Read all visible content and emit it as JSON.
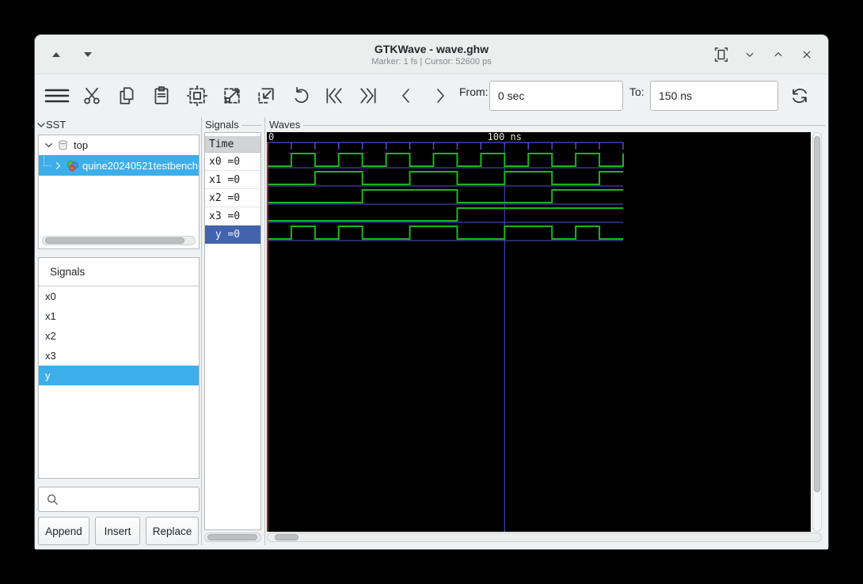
{
  "window": {
    "title": "GTKWave - wave.ghw",
    "subtitle": "Marker: 1 fs  |  Cursor: 52600 ps",
    "titlebar_icons": [
      "keep-above",
      "keep-below",
      "fit-window",
      "minimize",
      "maximize",
      "close"
    ]
  },
  "toolbar": {
    "icons": [
      "menu",
      "cut",
      "copy",
      "paste",
      "zoom-fit",
      "zoom-in",
      "zoom-out",
      "undo",
      "go-to-start",
      "go-to-end",
      "step-back",
      "step-forward",
      "reload"
    ],
    "from_label": "From:",
    "from_value": "0 sec",
    "to_label": "To:",
    "to_value": "150 ns"
  },
  "sst": {
    "label": "SST",
    "root_item": "top",
    "child_item": "quine20240521testbench"
  },
  "left_signals": {
    "header": "Signals",
    "items": [
      "x0",
      "x1",
      "x2",
      "x3",
      "y"
    ],
    "selected": "y",
    "search_placeholder": "",
    "buttons": {
      "append": "Append",
      "insert": "Insert",
      "replace": "Replace"
    }
  },
  "middle_signals": {
    "frame_label": "Signals",
    "rows": [
      {
        "text": "Time"
      },
      {
        "text": "x0 =0"
      },
      {
        "text": "x1 =0"
      },
      {
        "text": "x2 =0"
      },
      {
        "text": "x3 =0"
      },
      {
        "text": " y =0",
        "selected": true
      }
    ]
  },
  "waves": {
    "frame_label": "Waves",
    "timeline_start_label": "0",
    "timeline_major_label": "100 ns"
  },
  "colors": {
    "wave_green": "#1fb41f",
    "wave_blue": "#4343a4",
    "tick_blue": "#5555cc",
    "marker_red": "#c43c3c",
    "highlight_blue": "#3daee9",
    "selected_row_blue": "#4164ac",
    "wave_bg": "#000000"
  },
  "chart_data": {
    "type": "digital-waveform",
    "title": "Waves",
    "time_unit": "ns",
    "t_start": 0,
    "t_end": 150,
    "minor_tick_interval": 10,
    "major_tick": {
      "time": 100,
      "label": "100 ns"
    },
    "cursor_line_time": 100,
    "marker_time": 0,
    "signals": [
      {
        "name": "x0",
        "value_label": "x0 =0",
        "initial": 0,
        "toggles": [
          10,
          20,
          30,
          40,
          50,
          60,
          70,
          80,
          90,
          100,
          110,
          120,
          130,
          140,
          150
        ]
      },
      {
        "name": "x1",
        "value_label": "x1 =0",
        "initial": 0,
        "toggles": [
          20,
          40,
          60,
          80,
          100,
          120,
          140
        ]
      },
      {
        "name": "x2",
        "value_label": "x2 =0",
        "initial": 0,
        "toggles": [
          40,
          80,
          120
        ]
      },
      {
        "name": "x3",
        "value_label": "x3 =0",
        "initial": 0,
        "toggles": [
          80
        ]
      },
      {
        "name": "y",
        "value_label": " y =0",
        "initial": 0,
        "toggles": [
          10,
          20,
          30,
          40,
          60,
          80,
          100,
          120,
          130,
          140
        ]
      }
    ]
  }
}
